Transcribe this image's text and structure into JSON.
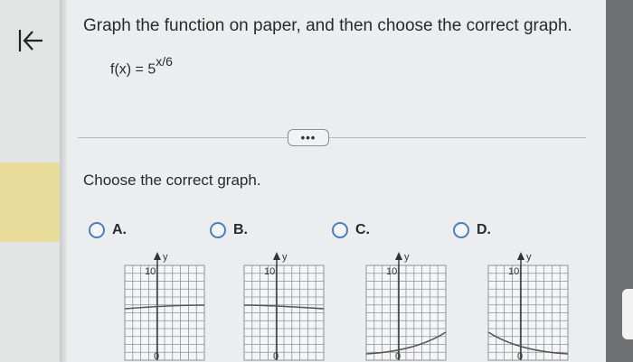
{
  "question": {
    "text": "Graph the function on paper, and then choose the correct graph.",
    "formula_base": "f(x) = 5",
    "formula_exponent": "x/6"
  },
  "more_button": "•••",
  "prompt": "Choose the correct graph.",
  "choices": [
    {
      "letter": "A.",
      "y_top": "10",
      "y_label": "y",
      "origin": "0"
    },
    {
      "letter": "B.",
      "y_top": "10",
      "y_label": "y",
      "origin": "0"
    },
    {
      "letter": "C.",
      "y_top": "10",
      "y_label": "y",
      "origin": "0"
    },
    {
      "letter": "D.",
      "y_top": "10",
      "y_label": "y",
      "origin": "0"
    }
  ],
  "colors": {
    "radio": "#4a7fbf",
    "curve": "#555555",
    "grid": "#8e9296",
    "rail_highlight": "#e7dc9b"
  },
  "icons": {
    "back": "arrow-left-bar-icon",
    "y_axis": "arrow-up-icon"
  }
}
